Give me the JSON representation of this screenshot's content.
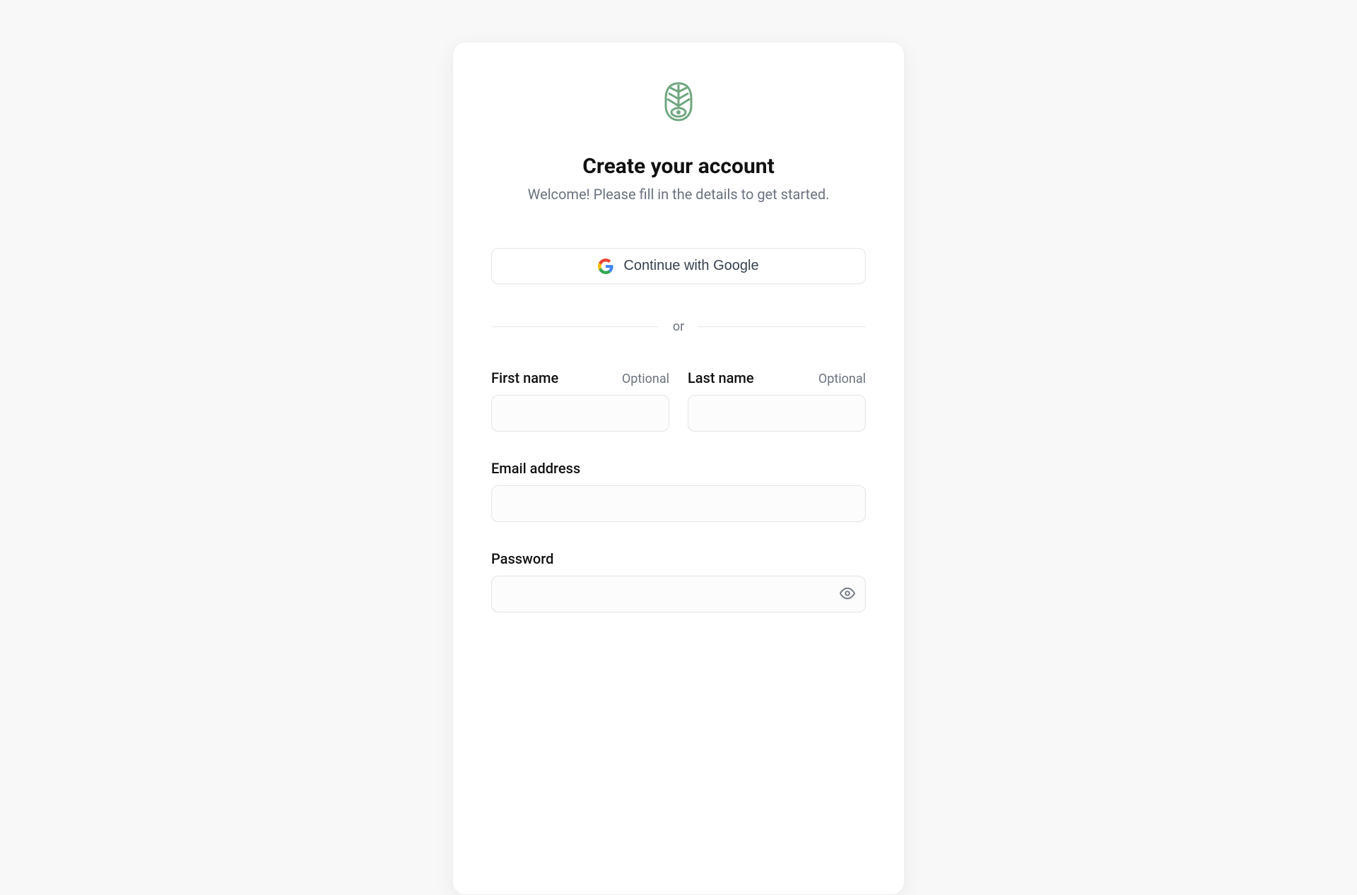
{
  "header": {
    "title": "Create your account",
    "subtitle": "Welcome! Please fill in the details to get started."
  },
  "oauth": {
    "google_label": "Continue with Google"
  },
  "divider": {
    "label": "or"
  },
  "form": {
    "first_name": {
      "label": "First name",
      "optional_text": "Optional",
      "value": ""
    },
    "last_name": {
      "label": "Last name",
      "optional_text": "Optional",
      "value": ""
    },
    "email": {
      "label": "Email address",
      "value": ""
    },
    "password": {
      "label": "Password",
      "value": ""
    }
  }
}
